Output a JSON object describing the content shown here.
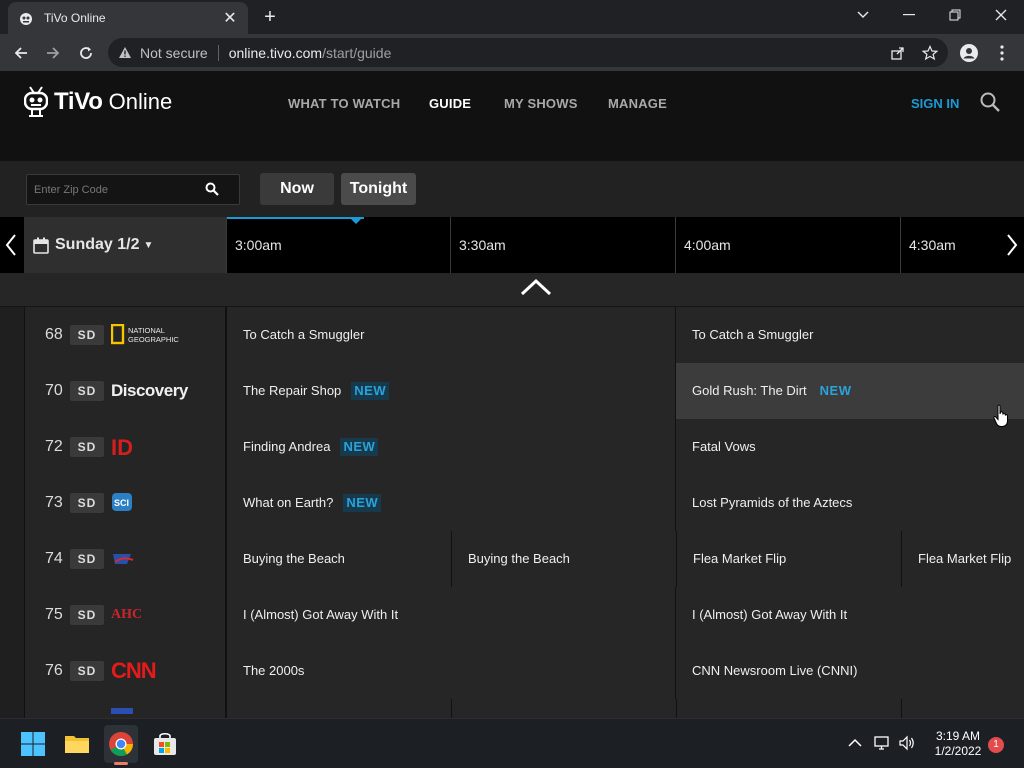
{
  "browser": {
    "tab_title": "TiVo Online",
    "security_label": "Not secure",
    "url_host": "online.tivo.com",
    "url_path": "/start/guide"
  },
  "site": {
    "brand": "TiVo",
    "brand_suffix": "Online",
    "nav": [
      "WHAT TO WATCH",
      "GUIDE",
      "MY SHOWS",
      "MANAGE"
    ],
    "active_nav": "GUIDE",
    "sign_in": "SIGN IN",
    "accent_color": "#1a9bd7"
  },
  "filters": {
    "zip_placeholder": "Enter Zip Code",
    "now_label": "Now",
    "tonight_label": "Tonight"
  },
  "guide": {
    "date": "Sunday 1/2",
    "times": [
      "3:00am",
      "3:30am",
      "4:00am",
      "4:30am"
    ],
    "rows": [
      {
        "num": "68",
        "quality": "SD",
        "logo": "NATIONAL GEOGRAPHIC",
        "programs": [
          {
            "title": "To Catch a Smuggler",
            "new": false
          },
          {
            "title": "To Catch a Smuggler",
            "new": false
          }
        ]
      },
      {
        "num": "70",
        "quality": "SD",
        "logo": "Discovery",
        "programs": [
          {
            "title": "The Repair Shop",
            "new": true
          },
          {
            "title": "Gold Rush: The Dirt",
            "new": true
          }
        ]
      },
      {
        "num": "72",
        "quality": "SD",
        "logo": "ID",
        "programs": [
          {
            "title": "Finding Andrea",
            "new": true
          },
          {
            "title": "Fatal Vows",
            "new": false
          }
        ]
      },
      {
        "num": "73",
        "quality": "SD",
        "logo": "SCI",
        "programs": [
          {
            "title": "What on Earth?",
            "new": true
          },
          {
            "title": "Lost Pyramids of the Aztecs",
            "new": false
          }
        ]
      },
      {
        "num": "74",
        "quality": "SD",
        "logo": "DESTINATION AMERICA",
        "programs": [
          {
            "title": "Buying the Beach",
            "new": false
          },
          {
            "title": "Buying the Beach",
            "new": false
          },
          {
            "title": "Flea Market Flip",
            "new": false
          },
          {
            "title": "Flea Market Flip",
            "new": false
          }
        ]
      },
      {
        "num": "75",
        "quality": "SD",
        "logo": "AHC",
        "programs": [
          {
            "title": "I (Almost) Got Away With It",
            "new": false
          },
          {
            "title": "I (Almost) Got Away With It",
            "new": false
          }
        ]
      },
      {
        "num": "76",
        "quality": "SD",
        "logo": "CNN",
        "programs": [
          {
            "title": "The 2000s",
            "new": false
          },
          {
            "title": "CNN Newsroom Live (CNNI)",
            "new": false
          }
        ]
      }
    ],
    "new_label": "NEW"
  },
  "taskbar": {
    "time": "3:19 AM",
    "date": "1/2/2022",
    "notifications": "1"
  }
}
